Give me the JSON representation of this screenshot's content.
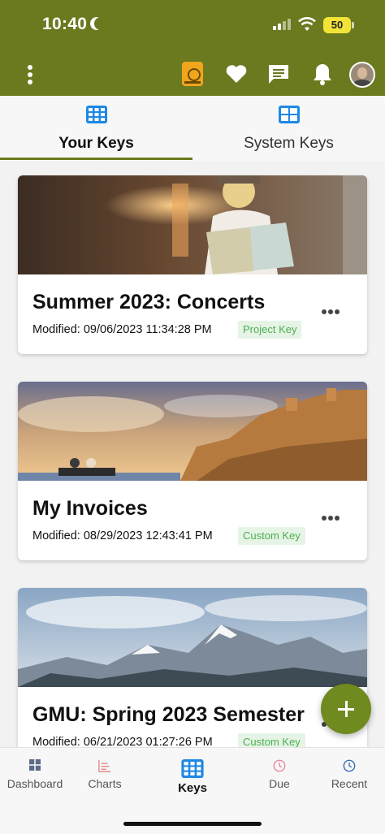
{
  "status_bar": {
    "time": "10:40",
    "battery": "50"
  },
  "header": {
    "icons": [
      "more-vertical-icon",
      "book-globe-icon",
      "heart-icon",
      "chat-icon",
      "bell-icon",
      "avatar"
    ]
  },
  "tabs": [
    {
      "label": "Your Keys",
      "active": true
    },
    {
      "label": "System Keys",
      "active": false
    }
  ],
  "cards": [
    {
      "title": "Summer 2023: Concerts",
      "modified": "Modified: 09/06/2023 11:34:28 PM",
      "badge": "Project Key"
    },
    {
      "title": "My Invoices",
      "modified": "Modified: 08/29/2023 12:43:41 PM",
      "badge": "Custom Key"
    },
    {
      "title": "GMU: Spring 2023 Semester",
      "modified": "Modified: 06/21/2023 01:27:26 PM",
      "badge": "Custom Key"
    }
  ],
  "bottom_nav": [
    {
      "label": "Dashboard",
      "icon": "dashboard-icon"
    },
    {
      "label": "Charts",
      "icon": "charts-icon"
    },
    {
      "label": "Keys",
      "icon": "keys-grid-icon",
      "active": true
    },
    {
      "label": "Due",
      "icon": "clock-icon"
    },
    {
      "label": "Recent",
      "icon": "clock-icon"
    }
  ],
  "colors": {
    "header": "#6b7a1e",
    "accent": "#1e88e5",
    "badge_text": "#4caf50",
    "fab": "#6f8a1f"
  }
}
